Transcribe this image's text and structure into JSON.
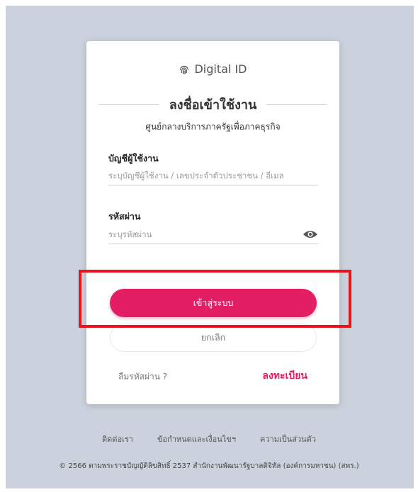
{
  "brand": {
    "name": "Digital ID",
    "icon": "fingerprint-icon"
  },
  "login": {
    "title": "ลงชื่อเข้าใช้งาน",
    "subtitle": "ศูนย์กลางบริการภาครัฐเพื่อภาคธุรกิจ",
    "username_label": "บัญชีผู้ใช้งาน",
    "username_placeholder": "ระบุบัญชีผู้ใช้งาน / เลขประจำตัวประชาชน / อีเมล",
    "password_label": "รหัสผ่าน",
    "password_placeholder": "ระบุรหัสผ่าน",
    "password_toggle_icon": "eye-icon",
    "submit_label": "เข้าสู่ระบบ",
    "cancel_label": "ยกเลิก",
    "forgot_label": "ลืมรหัสผ่าน ?",
    "register_label": "ลงทะเบียน"
  },
  "footer": {
    "links": [
      "ติดต่อเรา",
      "ข้อกำหนดและเงื่อนไขฯ",
      "ความเป็นส่วนตัว"
    ],
    "copyright": "© 2566 ตามพระราชบัญญัติลิขสิทธิ์ 2537 สำนักงานพัฒนารัฐบาลดิจิทัล (องค์การมหาชน) (สพร.)"
  },
  "colors": {
    "accent": "#e31e63",
    "background": "#ccd2dd",
    "highlight": "#e8141b"
  }
}
